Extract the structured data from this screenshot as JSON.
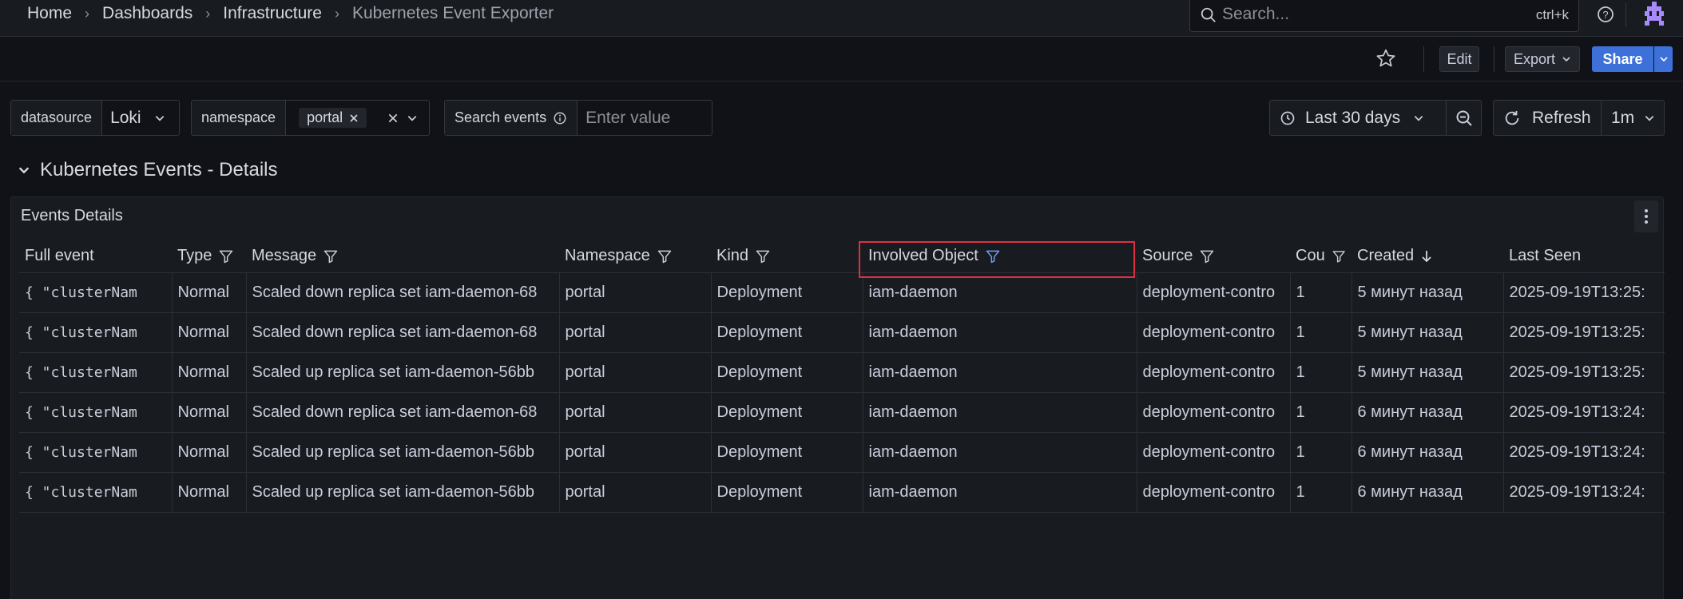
{
  "breadcrumb": [
    "Home",
    "Dashboards",
    "Infrastructure",
    "Kubernetes Event Exporter"
  ],
  "search": {
    "placeholder": "Search...",
    "shortcut": "ctrl+k"
  },
  "toolbar": {
    "edit_label": "Edit",
    "export_label": "Export",
    "share_label": "Share"
  },
  "variables": {
    "datasource": {
      "label": "datasource",
      "value": "Loki"
    },
    "namespace": {
      "label": "namespace",
      "value": "portal"
    },
    "search_events": {
      "label": "Search events",
      "placeholder": "Enter value"
    }
  },
  "time": {
    "range": "Last 30 days",
    "refresh_label": "Refresh",
    "interval": "1m"
  },
  "row": {
    "title": "Kubernetes Events - Details"
  },
  "panel": {
    "title": "Events Details",
    "columns": [
      "Full event",
      "Type",
      "Message",
      "Namespace",
      "Kind",
      "Involved Object",
      "Source",
      "Cou",
      "Created",
      "Last Seen"
    ],
    "rows": [
      [
        "{ \"clusterNam",
        "Normal",
        "Scaled down replica set iam-daemon-68",
        "portal",
        "Deployment",
        "iam-daemon",
        "deployment-contro",
        "1",
        "5 минут назад",
        "2025-09-19T13:25:"
      ],
      [
        "{ \"clusterNam",
        "Normal",
        "Scaled down replica set iam-daemon-68",
        "portal",
        "Deployment",
        "iam-daemon",
        "deployment-contro",
        "1",
        "5 минут назад",
        "2025-09-19T13:25:"
      ],
      [
        "{ \"clusterNam",
        "Normal",
        "Scaled up replica set iam-daemon-56bb",
        "portal",
        "Deployment",
        "iam-daemon",
        "deployment-contro",
        "1",
        "5 минут назад",
        "2025-09-19T13:25:"
      ],
      [
        "{ \"clusterNam",
        "Normal",
        "Scaled down replica set iam-daemon-68",
        "portal",
        "Deployment",
        "iam-daemon",
        "deployment-contro",
        "1",
        "6 минут назад",
        "2025-09-19T13:24:"
      ],
      [
        "{ \"clusterNam",
        "Normal",
        "Scaled up replica set iam-daemon-56bb",
        "portal",
        "Deployment",
        "iam-daemon",
        "deployment-contro",
        "1",
        "6 минут назад",
        "2025-09-19T13:24:"
      ],
      [
        "{ \"clusterNam",
        "Normal",
        "Scaled up replica set iam-daemon-56bb",
        "portal",
        "Deployment",
        "iam-daemon",
        "deployment-contro",
        "1",
        "6 минут назад",
        "2025-09-19T13:24:"
      ]
    ]
  },
  "colors": {
    "accent": "#3d71d9",
    "highlight": "#e02f44",
    "active_filter": "#6e9fff"
  }
}
